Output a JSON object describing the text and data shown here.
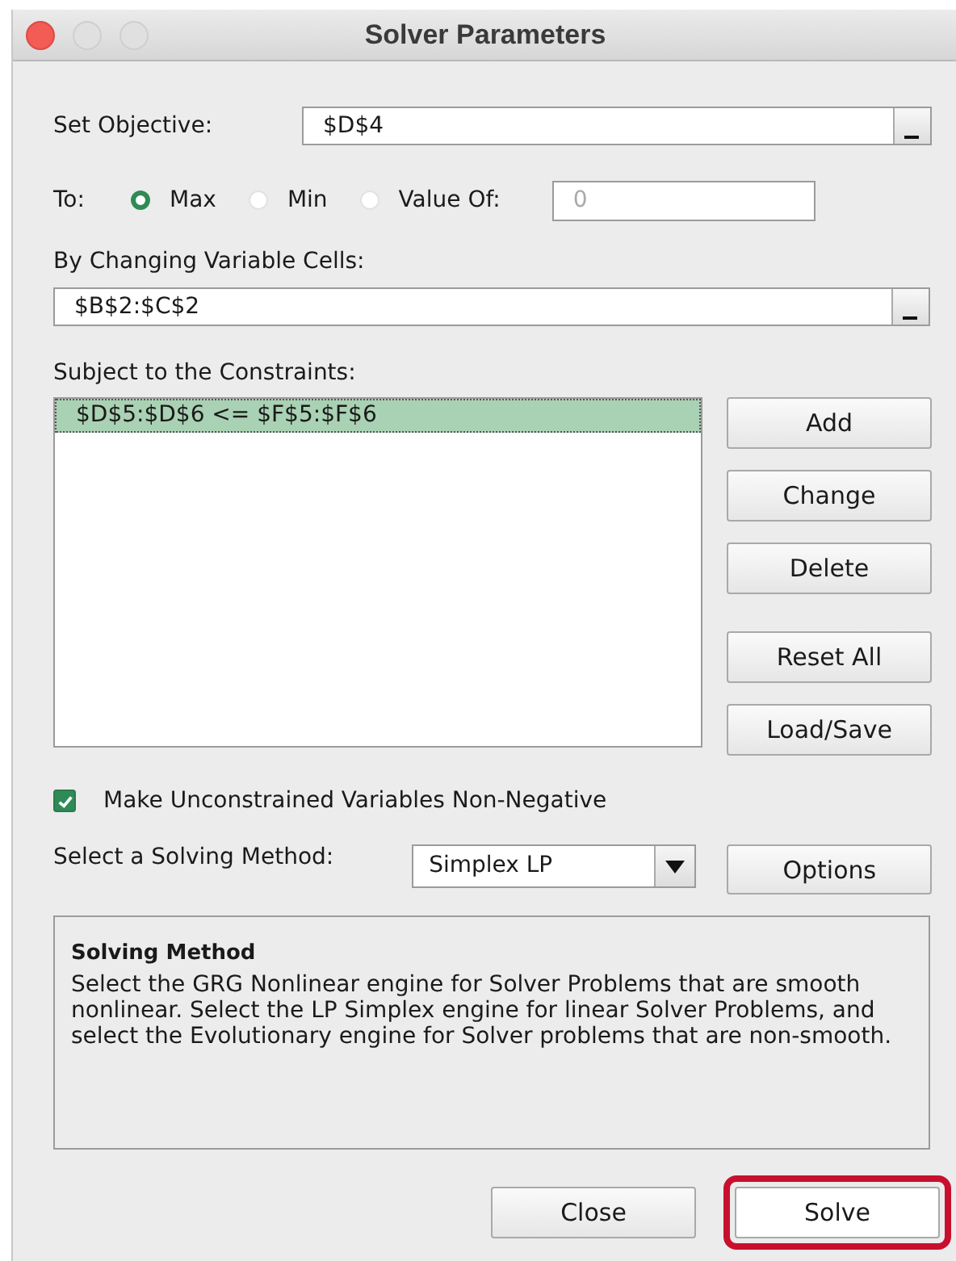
{
  "window": {
    "title": "Solver Parameters"
  },
  "objective": {
    "label": "Set Objective:",
    "value": "$D$4"
  },
  "to": {
    "label": "To:",
    "options": [
      {
        "label": "Max",
        "selected": true
      },
      {
        "label": "Min",
        "selected": false
      },
      {
        "label": "Value Of:",
        "selected": false
      }
    ],
    "value_field": {
      "placeholder": "0"
    }
  },
  "changing_cells": {
    "label": "By Changing Variable Cells:",
    "value": "$B$2:$C$2"
  },
  "constraints": {
    "label": "Subject to the Constraints:",
    "items": [
      {
        "text": "$D$5:$D$6 <= $F$5:$F$6",
        "selected": true
      }
    ]
  },
  "side_buttons": [
    "Add",
    "Change",
    "Delete",
    "Reset All",
    "Load/Save"
  ],
  "non_negative": {
    "label": "Make Unconstrained Variables Non-Negative",
    "checked": true
  },
  "method": {
    "label": "Select a Solving Method:",
    "value": "Simplex LP",
    "options_button": "Options"
  },
  "description": {
    "title": "Solving Method",
    "text": "Select the GRG Nonlinear engine for Solver Problems that are smooth nonlinear. Select the LP Simplex engine for linear Solver Problems, and select the Evolutionary engine for Solver problems that are non-smooth."
  },
  "footer_buttons": [
    {
      "label": "Close",
      "highlighted": false
    },
    {
      "label": "Solve",
      "highlighted": true
    }
  ]
}
